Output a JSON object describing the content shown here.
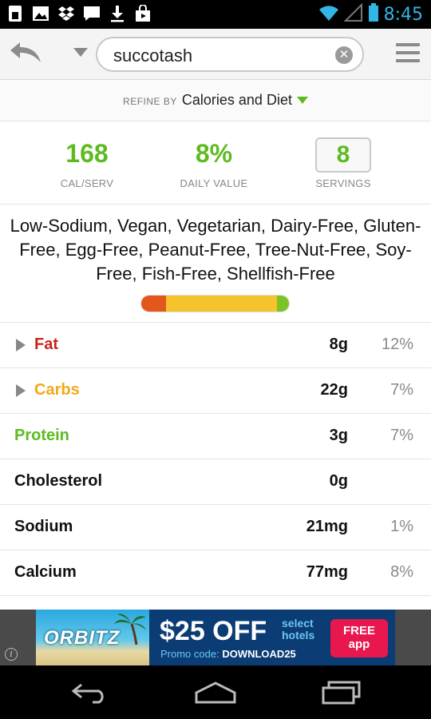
{
  "status_bar": {
    "time": "8:45",
    "left_icons": [
      "sim-card-icon",
      "image-icon",
      "dropbox-icon",
      "chat-icon",
      "download-icon",
      "shopping-bag-icon"
    ],
    "right_icons": [
      "wifi-icon",
      "signal-icon",
      "battery-icon"
    ]
  },
  "search": {
    "query": "succotash"
  },
  "refine": {
    "prefix": "REFINE BY",
    "value": "Calories and Diet"
  },
  "stats": {
    "calories": {
      "value": "168",
      "label": "CAL/SERV"
    },
    "daily_value": {
      "value": "8%",
      "label": "DAILY VALUE"
    },
    "servings": {
      "value": "8",
      "label": "SERVINGS"
    }
  },
  "diet_labels": "Low-Sodium, Vegan, Vegetarian, Dairy-Free, Gluten-Free, Egg-Free, Peanut-Free, Tree-Nut-Free, Soy-Free, Fish-Free, Shellfish-Free",
  "macro_bar": {
    "segments": [
      {
        "name": "fat",
        "fraction": 0.17,
        "color": "#e2571c"
      },
      {
        "name": "carbs",
        "fraction": 0.75,
        "color": "#f5c42c"
      },
      {
        "name": "protein",
        "fraction": 0.08,
        "color": "#7cc426"
      }
    ]
  },
  "nutrients": [
    {
      "name": "Fat",
      "amount": "8g",
      "percent": "12%",
      "color": "#c8261a",
      "expandable": true
    },
    {
      "name": "Carbs",
      "amount": "22g",
      "percent": "7%",
      "color": "#f2a91a",
      "expandable": true
    },
    {
      "name": "Protein",
      "amount": "3g",
      "percent": "7%",
      "color": "#5dbb1f",
      "expandable": false
    },
    {
      "name": "Cholesterol",
      "amount": "0g",
      "percent": "",
      "color": "#111111",
      "expandable": false
    },
    {
      "name": "Sodium",
      "amount": "21mg",
      "percent": "1%",
      "color": "#111111",
      "expandable": false
    },
    {
      "name": "Calcium",
      "amount": "77mg",
      "percent": "8%",
      "color": "#111111",
      "expandable": false
    }
  ],
  "ad": {
    "brand": "ORBITZ",
    "offer": "$25 OFF",
    "offer_sub": "select hotels",
    "promo_label": "Promo code:",
    "promo_code": "DOWNLOAD25",
    "cta": "FREE app",
    "info": "i"
  },
  "nav": {
    "buttons": [
      "back-icon",
      "home-icon",
      "recent-apps-icon"
    ]
  },
  "colors": {
    "accent_green": "#5dbb1f",
    "clock_blue": "#33b5e5"
  }
}
